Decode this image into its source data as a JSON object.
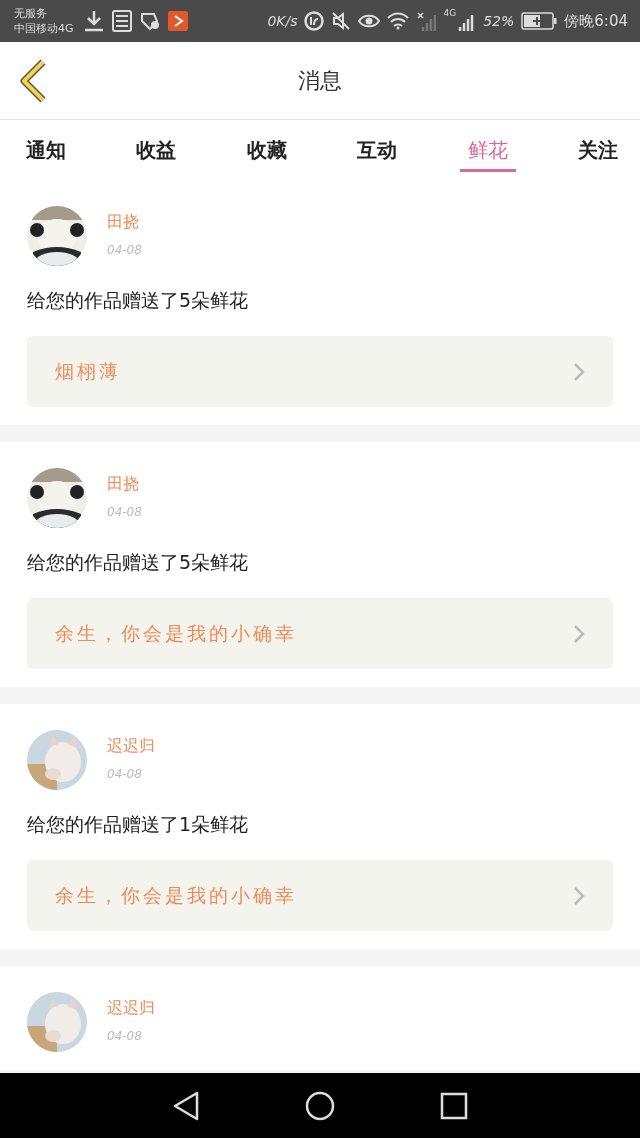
{
  "status_bar": {
    "carrier_top": "无服务",
    "carrier": "中国移动4G",
    "speed": "0K/s",
    "network": "4G",
    "battery": "52%",
    "time": "傍晚6:04"
  },
  "header": {
    "title": "消息"
  },
  "tabs": [
    {
      "label": "通知",
      "selected": false
    },
    {
      "label": "收益",
      "selected": false
    },
    {
      "label": "收藏",
      "selected": false
    },
    {
      "label": "互动",
      "selected": false
    },
    {
      "label": "鲜花",
      "selected": true
    },
    {
      "label": "关注",
      "selected": false
    }
  ],
  "messages": [
    {
      "name": "田挠",
      "date": "04-08",
      "text": "给您的作品赠送了5朵鲜花",
      "work": "烟栩薄"
    },
    {
      "name": "田挠",
      "date": "04-08",
      "text": "给您的作品赠送了5朵鲜花",
      "work": "余生，你会是我的小确幸"
    },
    {
      "name": "迟迟归",
      "date": "04-08",
      "text": "给您的作品赠送了1朵鲜花",
      "work": "余生，你会是我的小确幸"
    },
    {
      "name": "迟迟归",
      "date": "04-08"
    }
  ]
}
